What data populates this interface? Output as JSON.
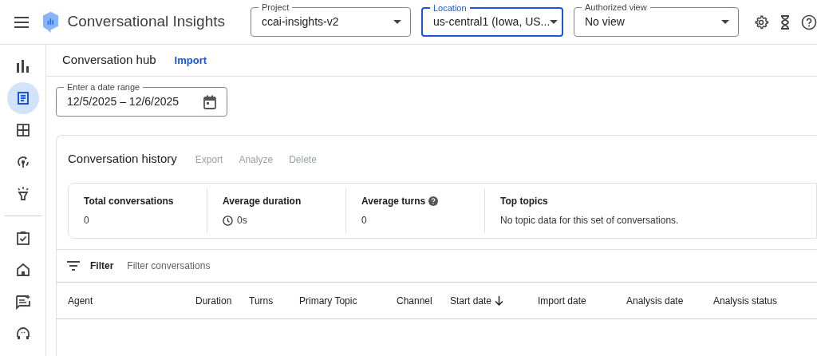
{
  "app": {
    "title": "Conversational Insights"
  },
  "header_fields": [
    {
      "label": "Project",
      "value": "ccai-insights-v2",
      "focused": false
    },
    {
      "label": "Location",
      "value": "us-central1 (Iowa, US...",
      "focused": true
    },
    {
      "label": "Authorized view",
      "value": "No view",
      "focused": false
    }
  ],
  "sidebar": {
    "groups": [
      [
        {
          "selected": false
        },
        {
          "selected": true
        },
        {
          "selected": false
        },
        {
          "selected": false
        },
        {
          "selected": false
        }
      ],
      [
        {
          "selected": false
        },
        {
          "selected": false
        },
        {
          "selected": false
        },
        {
          "selected": false
        }
      ]
    ]
  },
  "page": {
    "title": "Conversation hub",
    "action": "Import"
  },
  "date_range": {
    "label": "Enter a date range",
    "value": "12/5/2025 – 12/6/2025"
  },
  "history": {
    "title": "Conversation history",
    "actions": [
      {
        "label": "Export",
        "disabled": true
      },
      {
        "label": "Analyze",
        "disabled": true
      },
      {
        "label": "Delete",
        "disabled": true
      }
    ],
    "stats": [
      {
        "label": "Total conversations",
        "value": "0",
        "kind": "plain"
      },
      {
        "label": "Average duration",
        "value": "0s",
        "kind": "clock"
      },
      {
        "label": "Average turns",
        "value": "0",
        "kind": "help"
      },
      {
        "label": "Top topics",
        "value": "No topic data for this set of conversations.",
        "kind": "plain"
      }
    ],
    "filter": {
      "label": "Filter",
      "placeholder": "Filter conversations"
    },
    "columns": [
      {
        "label": "Agent",
        "sorted": false
      },
      {
        "label": "Duration",
        "sorted": false
      },
      {
        "label": "Turns",
        "sorted": false
      },
      {
        "label": "Primary Topic",
        "sorted": false
      },
      {
        "label": "Channel",
        "sorted": false
      },
      {
        "label": "Start date",
        "sorted": true
      },
      {
        "label": "Import date",
        "sorted": false
      },
      {
        "label": "Analysis date",
        "sorted": false
      },
      {
        "label": "Analysis status",
        "sorted": false
      }
    ]
  }
}
